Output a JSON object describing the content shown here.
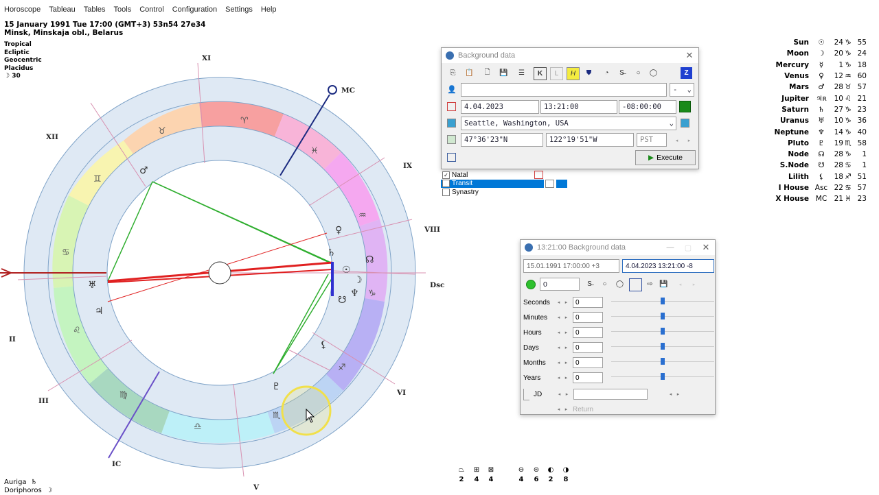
{
  "menu": [
    "Horoscope",
    "Tableau",
    "Tables",
    "Tools",
    "Control",
    "Configuration",
    "Settings",
    "Help"
  ],
  "chart_info": {
    "line1": "15 January 1991   Tue   17:00 (GMT+3) 53n54   27e34",
    "line2": "Minsk, Minskaja obl., Belarus"
  },
  "system_info": [
    "Tropical",
    "Ecliptic",
    "Geocentric",
    "Placidus",
    "☽  30"
  ],
  "houses": {
    "labels": [
      "MC",
      "XI",
      "XII",
      "II",
      "III",
      "IC",
      "V",
      "VI",
      "Dsc",
      "VIII",
      "IX"
    ]
  },
  "zodiac_ring_glyphs": [
    "♈",
    "♉",
    "♊",
    "♋",
    "♌",
    "♍",
    "♎",
    "♏",
    "♐",
    "♑",
    "♒",
    "♓"
  ],
  "inner_glyphs": [
    "♂",
    "☉",
    "♀",
    "♄",
    "☽",
    "♅",
    "♆",
    "♇",
    "♃",
    "☊",
    "☋",
    "⚸"
  ],
  "planets": [
    {
      "name": "Sun",
      "sym": "☉",
      "deg": "24",
      "sign": "♑",
      "min": "55"
    },
    {
      "name": "Moon",
      "sym": "☽",
      "deg": "20",
      "sign": "♑",
      "min": "24"
    },
    {
      "name": "Mercury",
      "sym": "☿",
      "deg": "1",
      "sign": "♑",
      "min": "18"
    },
    {
      "name": "Venus",
      "sym": "♀",
      "deg": "12",
      "sign": "♒",
      "min": "60"
    },
    {
      "name": "Mars",
      "sym": "♂",
      "deg": "28",
      "sign": "♉",
      "min": "57"
    },
    {
      "name": "Jupiter",
      "sym": "♃ʀ",
      "deg": "10",
      "sign": "♌",
      "min": "21"
    },
    {
      "name": "Saturn",
      "sym": "♄",
      "deg": "27",
      "sign": "♑",
      "min": "23"
    },
    {
      "name": "Uranus",
      "sym": "♅",
      "deg": "10",
      "sign": "♑",
      "min": "36"
    },
    {
      "name": "Neptune",
      "sym": "♆",
      "deg": "14",
      "sign": "♑",
      "min": "40"
    },
    {
      "name": "Pluto",
      "sym": "♇",
      "deg": "19",
      "sign": "♏",
      "min": "58"
    },
    {
      "name": "Node",
      "sym": "☊",
      "deg": "28",
      "sign": "♑",
      "min": "1"
    },
    {
      "name": "S.Node",
      "sym": "☋",
      "deg": "28",
      "sign": "♋",
      "min": "1"
    },
    {
      "name": "Lilith",
      "sym": "⚸",
      "deg": "18",
      "sign": "♐",
      "min": "51"
    },
    {
      "name": "I House",
      "sym": "Asc",
      "deg": "22",
      "sign": "♋",
      "min": "57"
    },
    {
      "name": "X House",
      "sym": "MC",
      "deg": "21",
      "sign": "♓",
      "min": "23"
    }
  ],
  "background_window": {
    "title": "Background data",
    "dropdown_value": "-",
    "date": "4.04.2023",
    "time": "13:21:00",
    "tz": "-08:00:00",
    "location": "Seattle, Washington, USA",
    "lat": "47°36'23\"N",
    "lon": "122°19'51\"W",
    "tzname": "PST",
    "execute_label": "Execute",
    "z_label": "Z"
  },
  "chart_list": [
    {
      "label": "Natal",
      "checked": true
    },
    {
      "label": "Transit",
      "checked": false
    },
    {
      "label": "Synastry",
      "checked": false
    }
  ],
  "transit_window": {
    "title": "13:21:00 Background data",
    "natal_field": "15.01.1991  17:00:00  +3",
    "transit_field": "4.04.2023   13:21:00  -8",
    "counter": "0",
    "rows": [
      {
        "label": "Seconds",
        "value": "0"
      },
      {
        "label": "Minutes",
        "value": "0"
      },
      {
        "label": "Hours",
        "value": "0"
      },
      {
        "label": "Days",
        "value": "0"
      },
      {
        "label": "Months",
        "value": "0"
      },
      {
        "label": "Years",
        "value": "0"
      }
    ],
    "jd_label": "JD",
    "return_label": "Return"
  },
  "aspect_counts": [
    {
      "sym": "⏢",
      "n": "2"
    },
    {
      "sym": "⊞",
      "n": "4"
    },
    {
      "sym": "⊠",
      "n": "4"
    },
    {
      "sym": "⊖",
      "n": "4"
    },
    {
      "sym": "⊜",
      "n": "6"
    },
    {
      "sym": "◐",
      "n": "2"
    },
    {
      "sym": "◑",
      "n": "8"
    }
  ],
  "fixed_stars": [
    {
      "name": "Auriga",
      "sym": "♄"
    },
    {
      "name": "Doriphoros",
      "sym": "☽"
    }
  ],
  "colors": {
    "outer_ring": "#dfe9f4",
    "aspect_green": "#2fae2f",
    "aspect_red": "#e02020",
    "mc_line": "#1a2a80",
    "cursor_highlight": "#f1e04a"
  }
}
